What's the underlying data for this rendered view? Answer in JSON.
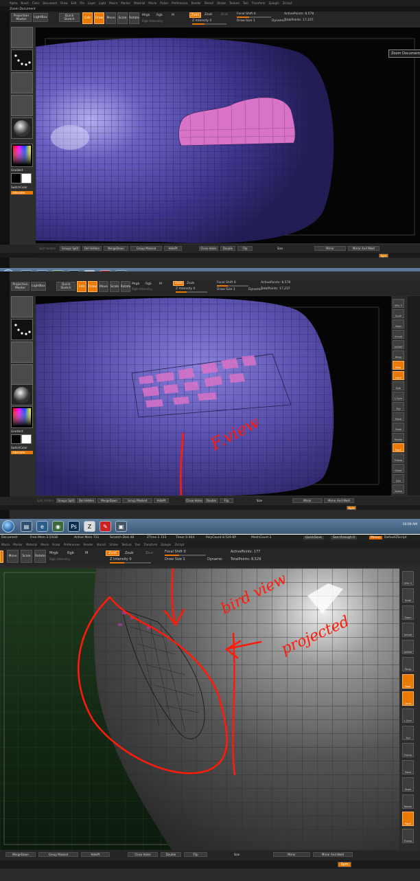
{
  "panel1": {
    "menu": [
      "Alpha",
      "Brush",
      "Color",
      "Document",
      "Draw",
      "Edit",
      "File",
      "Layer",
      "Light",
      "Macro",
      "Marker",
      "Material",
      "Movie",
      "Picker",
      "Preferences",
      "Render",
      "Stencil",
      "Stroke",
      "Texture",
      "Tool",
      "Transform",
      "Zplugin",
      "Zscript"
    ],
    "doc_title": "Zoom Document",
    "shelf": {
      "projection_master": "Projection Master",
      "lightbox": "LightBox",
      "quick_sketch": "Quick Sketch",
      "edit": "Edit",
      "draw": "Draw",
      "move": "Move",
      "scale": "Scale",
      "rotate": "Rotate",
      "mrgb": "Mrgb",
      "rgb": "Rgb",
      "m": "M",
      "rgb_intensity": "Rgb Intensity",
      "zadd": "Zadd",
      "zsub": "Zsub",
      "zcut": "Zcut",
      "z_intensity": "Z Intensity 0",
      "focal_shift": "Focal Shift 0",
      "draw_size": "Draw Size 1",
      "dynamic": "Dynamic",
      "active_points": "ActivePoints: 8,578",
      "total_points": "TotalPoints: 17,237"
    },
    "left": {
      "gradient": "Gradient",
      "switchcolor": "SwitchColor",
      "alternate": "Alternate"
    },
    "tooltip": "Zoom Document",
    "bottom": [
      "Split Hidden",
      "Groups Split",
      "Del Hidden",
      "MergeDown",
      "Group Masked",
      "HidePt",
      "Close Holes",
      "Double",
      "Flip",
      "Size",
      "Mirror",
      "Mirror And Weld"
    ],
    "bottom_right": "Sym"
  },
  "panel2": {
    "shelf": {
      "projection_master": "Projection Master",
      "lightbox": "LightBox",
      "quick_sketch": "Quick Sketch",
      "edit": "Edit",
      "draw": "Draw",
      "move": "Move",
      "scale": "Scale",
      "rotate": "Rotate",
      "mrgb": "Mrgb",
      "rgb": "Rgb",
      "m": "M",
      "rgb_intensity": "Rgb Intensity",
      "zadd": "Zadd",
      "zsub": "Zsub",
      "z_intensity": "Z Intensity 0",
      "focal_shift": "Focal Shift 0",
      "draw_size": "Draw Size 1",
      "dynamic": "Dynamic",
      "active_points": "ActivePoints: 8,578",
      "total_points": "TotalPoints: 17,237"
    },
    "left": {
      "gradient": "Gradient",
      "switchcolor": "SwitchColor",
      "alternate": "Alternate"
    },
    "right_tray": [
      "SPix 3",
      "Scroll",
      "Zoom",
      "Actual",
      "AAHalf",
      "Persp",
      "Floor",
      "Local",
      "Sym",
      "L.Sym",
      "Xyz",
      "Move",
      "Scale",
      "Rotate",
      "PolyF",
      "Transp",
      "Ghost",
      "Solo",
      "Xpose"
    ],
    "annotation": "F.view",
    "bottom": [
      "Split Hidden",
      "Groups Split",
      "Del Hidden",
      "MergeDown",
      "Group Masked",
      "HidePt",
      "Close Holes",
      "Double",
      "Flip",
      "Size",
      "Mirror",
      "Mirror And Weld"
    ],
    "bottom_right": "Sym",
    "tray_time": "10:09 AM"
  },
  "panel3": {
    "status": {
      "document": "Document",
      "free_mem": "Free Mem 3.55GB",
      "active_mem": "Active Mem 721",
      "scratch_disk": "Scratch Disk 48",
      "ztime": "ZTime 1.723",
      "timer": "Timer 0.004",
      "polycount": "PolyCount 8.529 KP",
      "meshcount": "MeshCount 2",
      "quicksave": "QuickSave",
      "see_through": "See-through 0",
      "menus": "Menus",
      "default_zscript": "DefaultZScript"
    },
    "menu": [
      "Macro",
      "Marker",
      "Material",
      "Movie",
      "Picker",
      "Preferences",
      "Render",
      "Stencil",
      "Stroke",
      "Texture",
      "Tool",
      "Transform",
      "Zplugin",
      "Zscript"
    ],
    "shelf": {
      "move": "Move",
      "scale": "Scale",
      "rotate": "Rotate",
      "mrgb": "Mrgb",
      "rgb": "Rgb",
      "m": "M",
      "rgb_intensity": "Rgb Intensity",
      "zadd": "Zadd",
      "zsub": "Zsub",
      "zcut": "Zcut",
      "z_intensity": "Z Intensity 0",
      "focal_shift": "Focal Shift 0",
      "draw_size": "Draw Size 1",
      "dynamic": "Dynamic",
      "active_points": "ActivePoints: 177",
      "total_points": "TotalPoints: 8,529"
    },
    "right_tray": [
      "SPix 3",
      "Scroll",
      "Zoom",
      "Actual",
      "AAHalf",
      "Persp",
      "Floor",
      "Local",
      "L.Sym",
      "Xyz",
      "Frame",
      "Move",
      "Scale",
      "Rotate",
      "PolyF",
      "Transp"
    ],
    "annotations": {
      "bird": "bird view",
      "projected": "projected"
    },
    "bottom": [
      "MergeDown",
      "Group Masked",
      "HidePt",
      "Close Holes",
      "Double",
      "Flip",
      "Size",
      "Mirror",
      "Mirror And Weld"
    ],
    "bottom_right": "Sym"
  },
  "colors": {
    "accent": "#e97900",
    "mesh": "#5a4fa8",
    "patch": "#d873c8",
    "ink": "#ff1a0a"
  }
}
